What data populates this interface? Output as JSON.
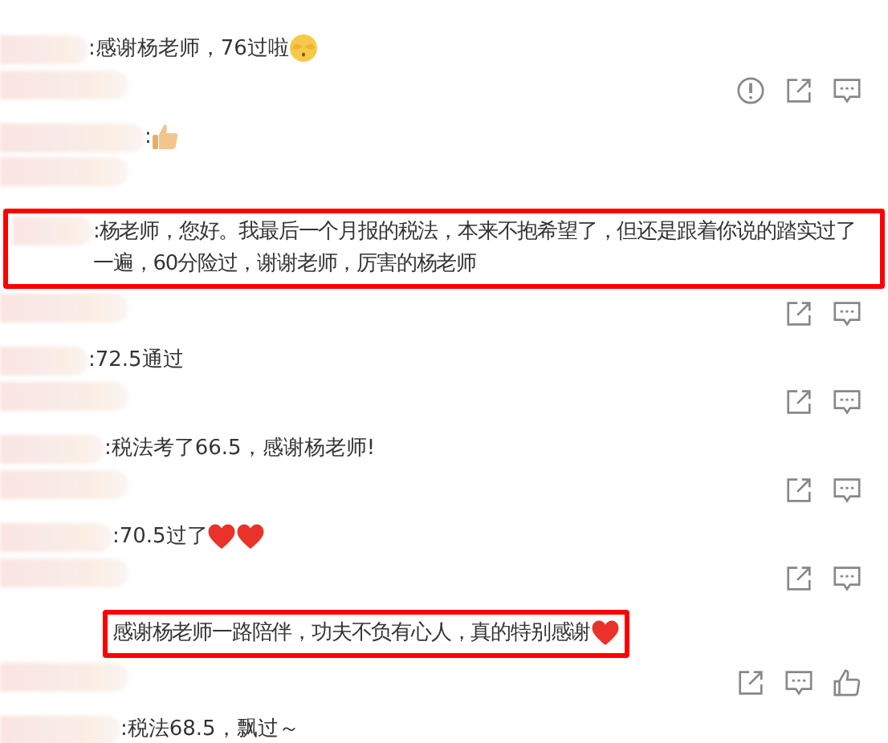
{
  "comments": [
    {
      "text": ":感谢杨老师，76过啦",
      "emojis": [
        {
          "kind": "covered-face"
        }
      ],
      "highlighted": false,
      "actions": [
        {
          "kind": "report"
        },
        {
          "kind": "share"
        },
        {
          "kind": "reply"
        }
      ]
    },
    {
      "text": ":",
      "emojis": [
        {
          "kind": "thumbs-up"
        }
      ],
      "highlighted": false
    },
    {
      "text": ":杨老师，您好。我最后一个月报的税法，本来不抱希望了，但还是跟着你说的踏实过了一遍，60分险过，谢谢老师，厉害的杨老师",
      "highlighted": true,
      "actions": [
        {
          "kind": "share"
        },
        {
          "kind": "reply"
        }
      ]
    },
    {
      "text": ":72.5通过",
      "highlighted": false,
      "actions": [
        {
          "kind": "share"
        },
        {
          "kind": "reply"
        }
      ]
    },
    {
      "text": ":税法考了66.5，感谢杨老师!",
      "highlighted": false,
      "actions": [
        {
          "kind": "share"
        },
        {
          "kind": "reply"
        }
      ]
    },
    {
      "text": ":70.5过了",
      "emojis": [
        {
          "kind": "heart"
        },
        {
          "kind": "heart"
        }
      ],
      "highlighted": false,
      "actions": [
        {
          "kind": "share"
        },
        {
          "kind": "reply"
        }
      ]
    },
    {
      "text": "感谢杨老师一路陪伴，功夫不负有心人，真的特别感谢",
      "emojis": [
        {
          "kind": "heart"
        }
      ],
      "highlighted": true,
      "actions": [
        {
          "kind": "share"
        },
        {
          "kind": "reply"
        },
        {
          "kind": "like"
        }
      ]
    },
    {
      "text": ":税法68.5，飘过～",
      "highlighted": false
    }
  ]
}
